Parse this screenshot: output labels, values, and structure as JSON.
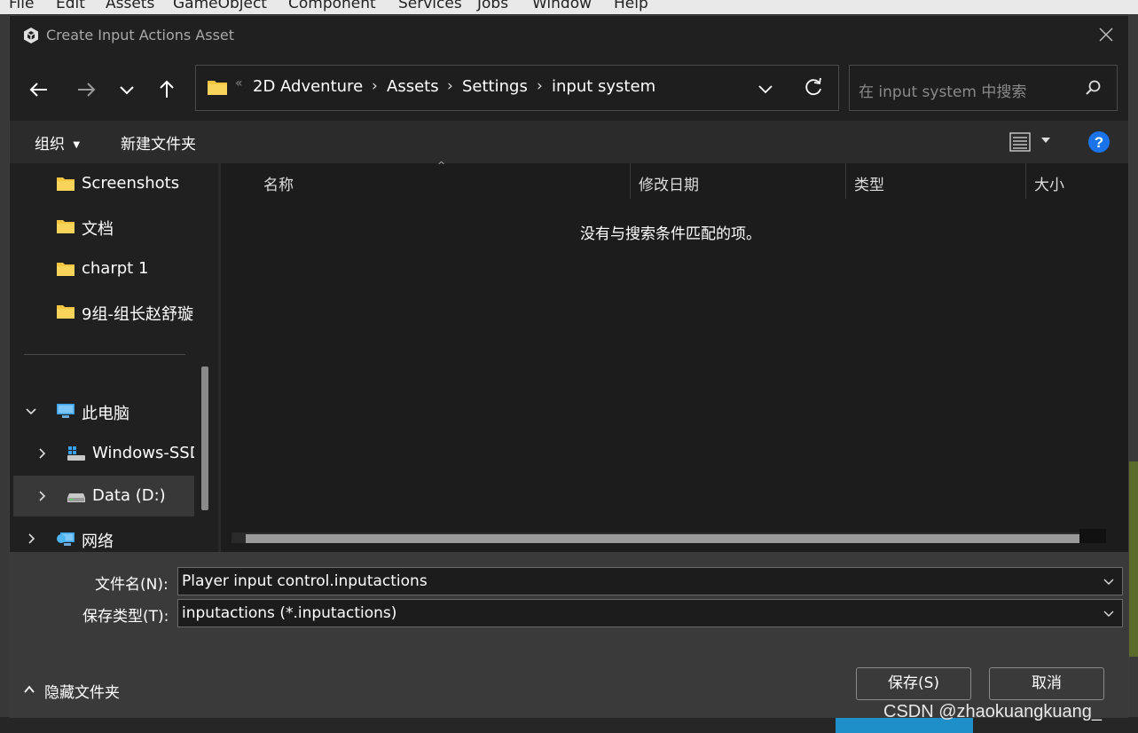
{
  "editor_menu": {
    "items": [
      "File",
      "Edit",
      "Assets",
      "GameObject",
      "Component",
      "Services",
      "Jobs",
      "Window",
      "Help"
    ]
  },
  "dialog": {
    "title": "Create Input Actions Asset"
  },
  "address_bar": {
    "overflow_marker": "«",
    "breadcrumbs": [
      "2D Adventure",
      "Assets",
      "Settings",
      "input system"
    ],
    "separator": "›"
  },
  "search": {
    "placeholder": "在 input system 中搜索"
  },
  "toolbar": {
    "organize_label": "组织",
    "new_folder_label": "新建文件夹"
  },
  "sidebar": {
    "items": [
      {
        "label": "Screenshots",
        "icon": "folder-icon"
      },
      {
        "label": "文档",
        "icon": "folder-icon"
      },
      {
        "label": "charpt 1",
        "icon": "folder-icon"
      },
      {
        "label": "9组-组长赵舒璇",
        "icon": "folder-icon"
      },
      {
        "label": "此电脑",
        "icon": "computer-icon"
      },
      {
        "label": "Windows-SSD",
        "icon": "drive-icon"
      },
      {
        "label": "Data (D:)",
        "icon": "drive-icon"
      },
      {
        "label": "网络",
        "icon": "network-icon"
      }
    ]
  },
  "file_list": {
    "columns": [
      "名称",
      "修改日期",
      "类型",
      "大小"
    ],
    "empty_message": "没有与搜索条件匹配的项。"
  },
  "footer": {
    "filename_label": "文件名(N):",
    "filename_value": "Player input control.inputactions",
    "filetype_label": "保存类型(T):",
    "filetype_value": "inputactions (*.inputactions)",
    "hide_folders_label": "隐藏文件夹",
    "save_label": "保存(S)",
    "cancel_label": "取消"
  },
  "watermark": "CSDN @zhaokuangkuang_",
  "colors": {
    "dialog_bg": "#202020",
    "footer_bg": "#3a3a3a",
    "folder_yellow": "#f4c542",
    "help_blue": "#1a73e8"
  }
}
